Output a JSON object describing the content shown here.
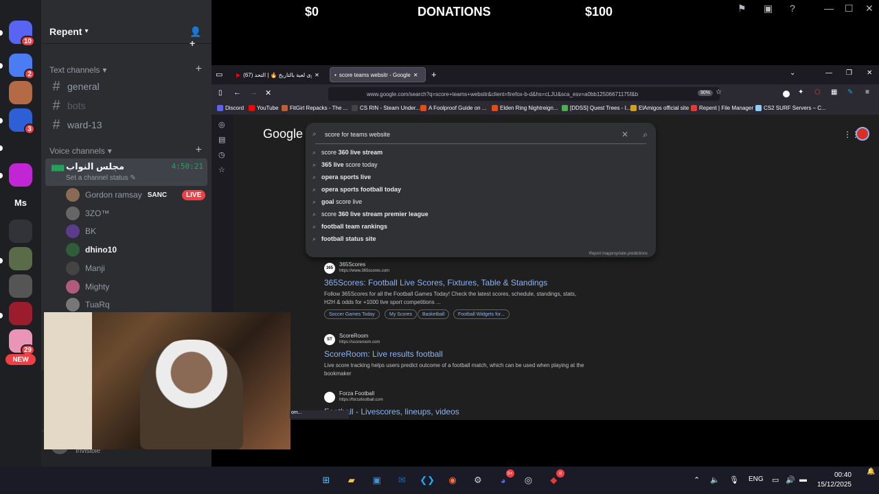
{
  "overlay": {
    "left_amount": "$0",
    "title": "DONATIONS",
    "right_amount": "$100"
  },
  "rail": {
    "servers": [
      {
        "label": "",
        "badge": "10",
        "color": "#5865f2",
        "icon": "discord-icon"
      },
      {
        "label": "",
        "badge": "2",
        "color": "#4c7cf3",
        "icon": "server-icon"
      },
      {
        "label": "",
        "badge": "",
        "color": "#b46b45",
        "icon": "server-icon"
      },
      {
        "label": "",
        "badge": "3",
        "color": "#2f5fd6",
        "icon": "server-icon"
      },
      {
        "label": "",
        "badge": "",
        "color": "#1e1f22",
        "icon": "server-icon"
      },
      {
        "label": "",
        "badge": "",
        "color": "#c026d3",
        "icon": "server-icon"
      },
      {
        "label": "Ms",
        "badge": "",
        "color": "#1e1f22",
        "icon": "server-icon"
      },
      {
        "label": "",
        "badge": "",
        "color": "#313338",
        "icon": "folder-icon"
      },
      {
        "label": "",
        "badge": "",
        "color": "#5a6b4a",
        "icon": "server-icon"
      },
      {
        "label": "",
        "badge": "",
        "color": "#555555",
        "icon": "server-icon"
      },
      {
        "label": "",
        "badge": "",
        "color": "#9b1c2c",
        "icon": "server-icon"
      },
      {
        "label": "",
        "badge": "29",
        "color": "#e895b8",
        "icon": "server-icon"
      }
    ],
    "new_label": "NEW"
  },
  "sidebar": {
    "guild_name": "Repent",
    "text_category": "Text channels",
    "text_channels": [
      "general",
      "bots",
      "ward-13"
    ],
    "voice_category": "Voice channels",
    "voice_channel": {
      "name": "مجلس النواب",
      "time": "4:50:21",
      "status": "Set a channel status"
    },
    "members": [
      {
        "name": "Gordon ramsay",
        "tag": "SANC",
        "live": "LIVE",
        "color": "#8a6a55"
      },
      {
        "name": "3ZO™",
        "tag": "",
        "live": "",
        "color": "#666666"
      },
      {
        "name": "BK",
        "tag": "",
        "live": "",
        "color": "#5b3b8a"
      },
      {
        "name": "dhino10",
        "tag": "",
        "live": "",
        "color": "#2f5d3a"
      },
      {
        "name": "Manji",
        "tag": "",
        "live": "",
        "color": "#444444"
      },
      {
        "name": "Mighty",
        "tag": "",
        "live": "",
        "color": "#b05b7a"
      },
      {
        "name": "TuaRq",
        "tag": "",
        "live": "",
        "color": "#777777"
      }
    ],
    "voice_connected_label": "Vo",
    "user": {
      "name": "Ma",
      "status": "Invisible"
    }
  },
  "browser": {
    "tabs": [
      {
        "label": "اقوى لعبة بالتاريخ 🔥 | التحد (67)",
        "active": false
      },
      {
        "label": "score teams websitr - Google S",
        "active": true
      }
    ],
    "url": "www.google.com/search?q=score+teams+websitr&client=firefox-b-d&hs=cLJU&sca_esv=a0bb12506671175f&b",
    "zoom": "90%",
    "bookmarks": [
      {
        "label": "Discord",
        "color": "#5865f2"
      },
      {
        "label": "YouTube",
        "color": "#ff0000"
      },
      {
        "label": "FitGirl Repacks - The ...",
        "color": "#c06030"
      },
      {
        "label": "CS RIN - Steam Under...",
        "color": "#444444"
      },
      {
        "label": "A Foolproof Guide on ...",
        "color": "#e64a19"
      },
      {
        "label": "Elden Ring Nightreign...",
        "color": "#e64a19"
      },
      {
        "label": "[DDSS] Quest Trees - I...",
        "color": "#4caf50"
      },
      {
        "label": "ElAmigos official site",
        "color": "#d4a017"
      },
      {
        "label": "Repent | File Manager",
        "color": "#e53935"
      },
      {
        "label": "CS2 SURF Servers – C...",
        "color": "#90caf9"
      }
    ],
    "google": {
      "logo": "Google",
      "query": "score for teams website",
      "suggestions": [
        {
          "plain": "score ",
          "bold": "360 live stream",
          "after": ""
        },
        {
          "plain": "",
          "bold": "365 live",
          "after": " score today"
        },
        {
          "plain": "",
          "bold": "opera sports live",
          "after": ""
        },
        {
          "plain": "",
          "bold": "opera sports football today",
          "after": ""
        },
        {
          "plain": "",
          "bold": "goal",
          "after": " score live"
        },
        {
          "plain": "score ",
          "bold": "360 live stream premier league",
          "after": ""
        },
        {
          "plain": "",
          "bold": "football team rankings",
          "after": ""
        },
        {
          "plain": "",
          "bold": "football status site",
          "after": ""
        }
      ],
      "report": "Report inappropriate predictions",
      "results": [
        {
          "fav": "365",
          "site": "365Scores",
          "url": "https://www.365scores.com",
          "title": "365Scores: Football Live Scores, Fixtures, Table & Standings",
          "snippet_bold": "365Scores",
          "snippet": "Follow 365Scores for all the Football Games Today! Check the latest scores, schedule, standings, stats, H2H & odds for +1000 live sport competitions ...",
          "chips": [
            "Soccer Games Today",
            "My Scores",
            "Basketball",
            "Football Widgets for..."
          ]
        },
        {
          "fav": "ST",
          "site": "ScoreRoom",
          "url": "https://scoreroom.com",
          "title": "ScoreRoom: Live results football",
          "snippet": "Live score tracking helps users predict outcome of a football match, which can be used when playing at the bookmaker",
          "chips": []
        },
        {
          "fav": "",
          "site": "Forza Football",
          "url": "https://forzafootball.com",
          "title": "Football - Livescores, lineups, videos",
          "snippet": "",
          "chips": []
        }
      ]
    },
    "status_text": "om..."
  },
  "taskbar": {
    "apps": [
      "windows-start-icon",
      "file-explorer-icon",
      "store-icon",
      "outlook-icon",
      "vscode-icon",
      "firefox-icon",
      "steam-icon",
      "discord-icon",
      "obs-icon",
      "app-icon"
    ],
    "discord_badge": "9+",
    "app_badge": "8",
    "lang": "ENG",
    "time": "00:40",
    "date": "15/12/2025"
  }
}
